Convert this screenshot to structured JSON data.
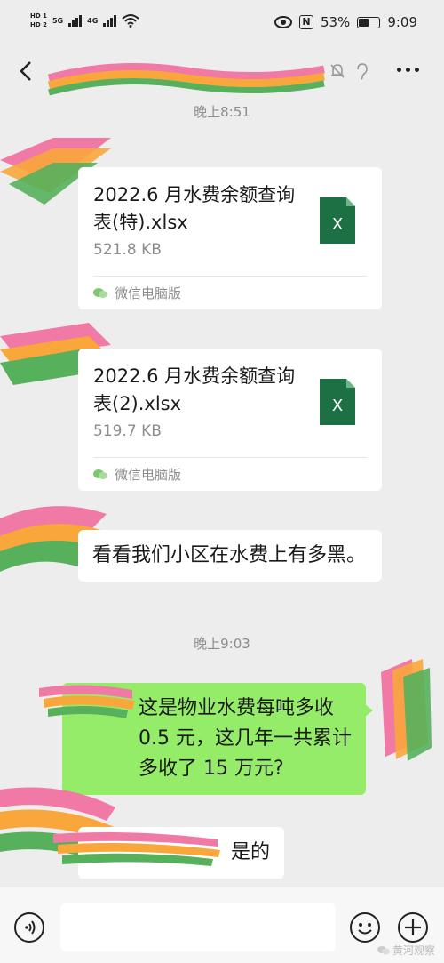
{
  "status_bar": {
    "sim1": "HD 1",
    "sim2": "HD 2",
    "net1": "5G",
    "net2": "4G",
    "battery_pct": "53%",
    "battery_level": 0.53,
    "time": "9:09",
    "nfc_label": "N"
  },
  "nav": {
    "icons": [
      "back-icon",
      "mute-icon",
      "ear-icon",
      "more-icon"
    ]
  },
  "messages": {
    "timestamp1": "晚上8:51",
    "file1": {
      "name": "2022.6 月水费余额查询表(特).xlsx",
      "size": "521.8 KB",
      "source": "微信电脑版",
      "icon_label": "X"
    },
    "file2": {
      "name": "2022.6 月水费余额查询表(2).xlsx",
      "size": "519.7 KB",
      "source": "微信电脑版",
      "icon_label": "X"
    },
    "text1": "看看我们小区在水费上有多黑。",
    "timestamp2": "晚上9:03",
    "text2": "这是物业水费每吨多收 0.5 元，这几年一共累计多收了 15 万元?",
    "text3": "是的"
  },
  "input_bar": {
    "placeholder": "",
    "icons": [
      "voice-icon",
      "emoji-icon",
      "plus-icon"
    ]
  },
  "watermark": "黄河观察",
  "colors": {
    "background": "#ededed",
    "outgoing_bubble": "#95ec69",
    "incoming_bubble": "#ffffff",
    "excel_green": "#1d7044",
    "timestamp_gray": "#8c8c8c"
  }
}
